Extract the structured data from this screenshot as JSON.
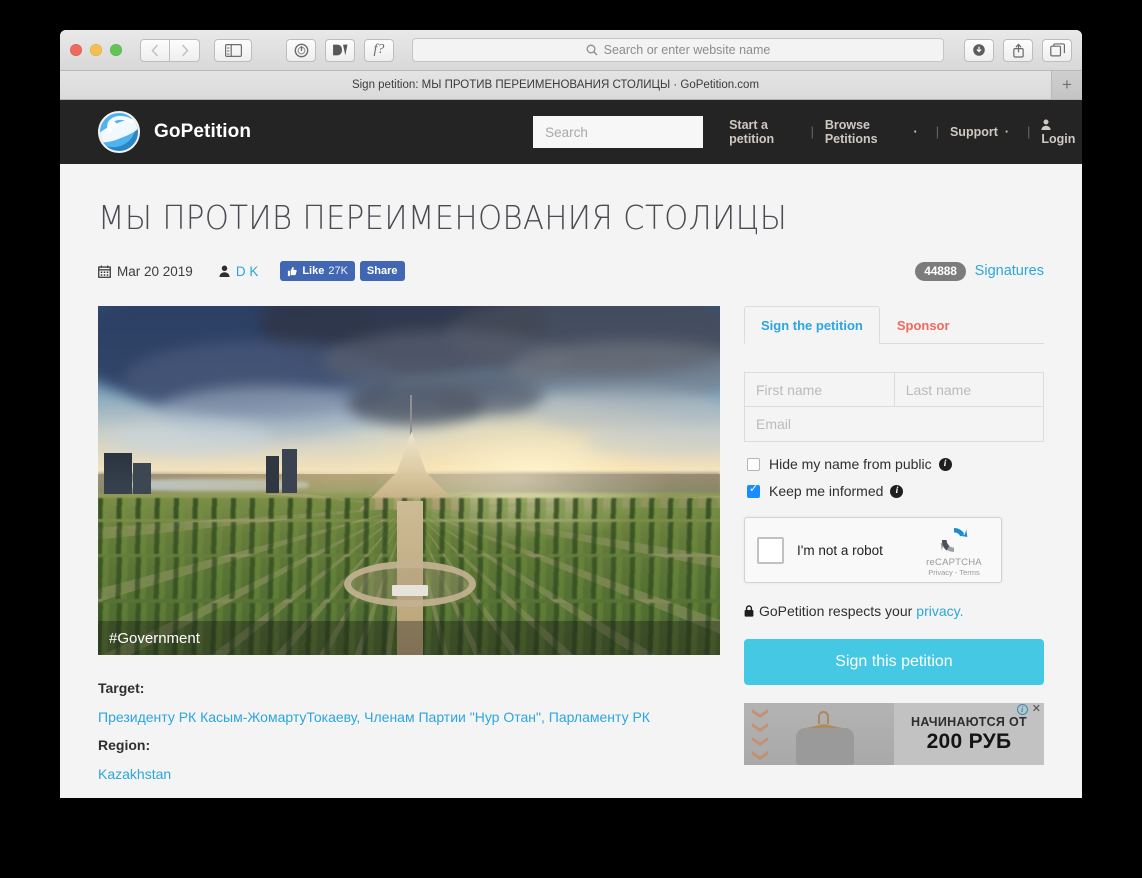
{
  "browser": {
    "window_controls": [
      "close",
      "minimize",
      "zoom"
    ],
    "nav": {
      "back_label": "‹",
      "forward_label": "›"
    },
    "sidebar_icon": "sidebar-icon",
    "extensions": [
      "adblock-icon",
      "dashlane-icon",
      "font-tool-icon"
    ],
    "extension_labels": {
      "font_tool": "f?"
    },
    "url_bar": {
      "placeholder": "Search or enter website name",
      "value": "",
      "search_icon": "search-icon"
    },
    "right_buttons": [
      "downloads-icon",
      "share-icon",
      "tabs-icon"
    ],
    "tab": {
      "title": "Sign petition: МЫ ПРОТИВ ПЕРЕИМЕНОВАНИЯ СТОЛИЦЫ · GoPetition.com",
      "new_tab_label": "+"
    }
  },
  "site": {
    "brand": "GoPetition",
    "logo_icon": "gopetition-logo-icon",
    "search": {
      "placeholder": "Search",
      "value": ""
    },
    "nav": [
      {
        "label": "Start a petition",
        "has_caret": false
      },
      {
        "label": "Browse Petitions",
        "has_caret": true
      },
      {
        "label": "Support",
        "has_caret": true
      },
      {
        "label": "Login",
        "has_caret": false,
        "icon": "person-icon"
      }
    ],
    "nav_separator": "|",
    "nav_caret": "·",
    "person_glyph": "@"
  },
  "petition": {
    "title": "МЫ ПРОТИВ ПЕРЕИМЕНОВАНИЯ СТОЛИЦЫ",
    "date": "Mar 20 2019",
    "calendar_icon": "calendar-icon",
    "author_icon": "person-icon",
    "author": "D K",
    "facebook": {
      "like_icon": "thumbs-up-icon",
      "like_label": "Like",
      "like_count": "27K",
      "share_label": "Share"
    },
    "signatures": {
      "count": "44888",
      "label": "Signatures"
    },
    "hero": {
      "tag": "#Government",
      "alt": "aerial-view-of-astana-khan-shatyr-park"
    },
    "target_label": "Target:",
    "target_value": "Президенту РК Касым-ЖомартуТокаеву, Членам Партии \"Нур Отан\", Парламенту РК",
    "region_label": "Region:",
    "region_value": "Kazakhstan"
  },
  "sidebar": {
    "tabs": [
      {
        "label": "Sign the petition",
        "active": true
      },
      {
        "label": "Sponsor",
        "active": false
      }
    ],
    "form": {
      "first_name": {
        "placeholder": "First name",
        "value": ""
      },
      "last_name": {
        "placeholder": "Last name",
        "value": ""
      },
      "email": {
        "placeholder": "Email",
        "value": ""
      },
      "hide_name": {
        "label": "Hide my name from public",
        "checked": false,
        "info_icon": "info-icon"
      },
      "keep_informed": {
        "label": "Keep me informed",
        "checked": true,
        "info_icon": "info-icon"
      }
    },
    "recaptcha": {
      "checkbox_label": "I'm not a robot",
      "brand": "reCAPTCHA",
      "terms": "Privacy - Terms",
      "logo_icon": "recaptcha-logo-icon"
    },
    "privacy": {
      "lock_icon": "lock-icon",
      "text": "GoPetition respects your",
      "link": "privacy."
    },
    "cta_label": "Sign this petition"
  },
  "ad": {
    "line1": "НАЧИНАЮТСЯ ОТ",
    "line2": "200 РУБ",
    "info_icon": "ad-info-icon",
    "info_glyph": "i",
    "close_icon": "ad-close-icon",
    "close_glyph": "✕",
    "image_alt": "grey-hoodie-on-wooden-hanger"
  },
  "colors": {
    "header_bg": "#242424",
    "accent_blue": "#2ba6e0",
    "cta_cyan": "#44c8e4",
    "sponsor_red": "#f2685c",
    "facebook_blue": "#4267b2",
    "badge_grey": "#7c7c7c",
    "page_bg": "#f4f4f4",
    "checkbox_checked": "#1a8cff"
  }
}
